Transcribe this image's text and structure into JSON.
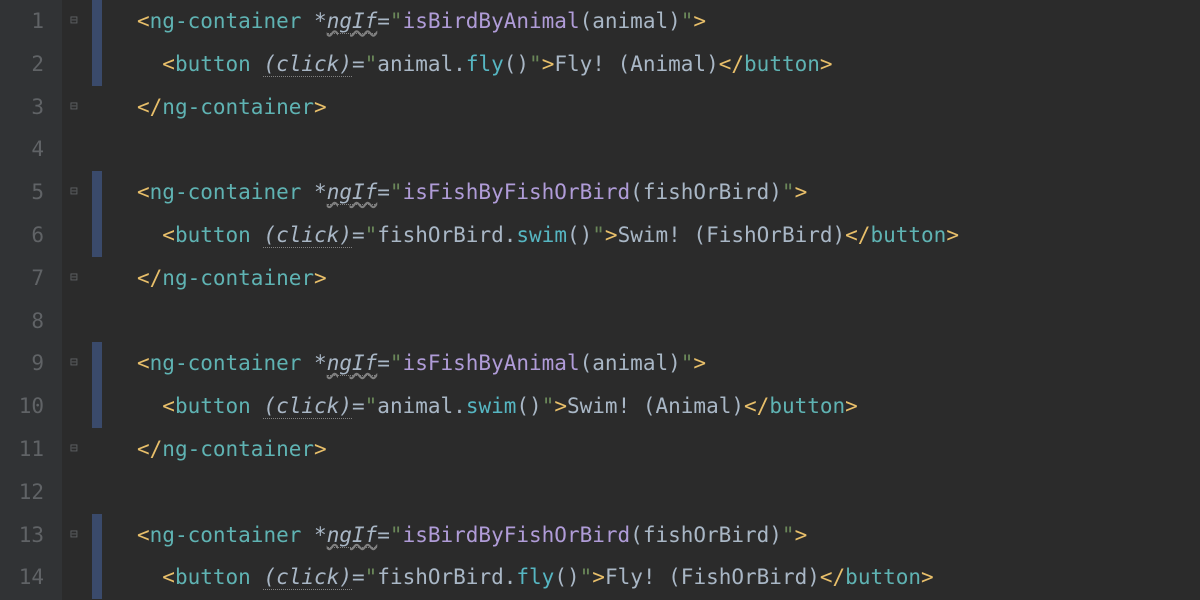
{
  "line_numbers": [
    "1",
    "2",
    "3",
    "4",
    "5",
    "6",
    "7",
    "8",
    "9",
    "10",
    "11",
    "12",
    "13",
    "14"
  ],
  "code_lines": [
    {
      "indent_bar": 1,
      "fold": "open",
      "tokens": [
        {
          "cls": "tag-punct",
          "t": "<"
        },
        {
          "cls": "tag-name",
          "t": "ng-container "
        },
        {
          "cls": "dir-star",
          "t": "*"
        },
        {
          "cls": "dir-name squiggle",
          "t": "ngIf"
        },
        {
          "cls": "attr-eq",
          "t": "="
        },
        {
          "cls": "str-q",
          "t": "\""
        },
        {
          "cls": "expr-fn",
          "t": "isBirdByAnimal"
        },
        {
          "cls": "expr-punct",
          "t": "("
        },
        {
          "cls": "expr-id",
          "t": "animal"
        },
        {
          "cls": "expr-punct",
          "t": ")"
        },
        {
          "cls": "str-q",
          "t": "\""
        },
        {
          "cls": "tag-punct",
          "t": ">"
        }
      ]
    },
    {
      "indent_bar": 1,
      "tokens": [
        {
          "cls": "plain-text",
          "t": "  "
        },
        {
          "cls": "tag-punct",
          "t": "<"
        },
        {
          "cls": "tag-name",
          "t": "button "
        },
        {
          "cls": "dir-name",
          "t": "(click)"
        },
        {
          "cls": "attr-eq",
          "t": "="
        },
        {
          "cls": "str-q",
          "t": "\""
        },
        {
          "cls": "expr-id",
          "t": "animal"
        },
        {
          "cls": "expr-punct",
          "t": "."
        },
        {
          "cls": "expr-method",
          "t": "fly"
        },
        {
          "cls": "expr-punct",
          "t": "()"
        },
        {
          "cls": "str-q",
          "t": "\""
        },
        {
          "cls": "tag-punct",
          "t": ">"
        },
        {
          "cls": "plain-text",
          "t": "Fly! (Animal)"
        },
        {
          "cls": "tag-punct",
          "t": "</"
        },
        {
          "cls": "tag-name",
          "t": "button"
        },
        {
          "cls": "tag-punct",
          "t": ">"
        }
      ]
    },
    {
      "fold": "close",
      "tokens": [
        {
          "cls": "tag-punct",
          "t": "</"
        },
        {
          "cls": "tag-name",
          "t": "ng-container"
        },
        {
          "cls": "tag-punct",
          "t": ">"
        }
      ]
    },
    {
      "tokens": []
    },
    {
      "indent_bar": 1,
      "fold": "open",
      "tokens": [
        {
          "cls": "tag-punct",
          "t": "<"
        },
        {
          "cls": "tag-name",
          "t": "ng-container "
        },
        {
          "cls": "dir-star",
          "t": "*"
        },
        {
          "cls": "dir-name squiggle",
          "t": "ngIf"
        },
        {
          "cls": "attr-eq",
          "t": "="
        },
        {
          "cls": "str-q",
          "t": "\""
        },
        {
          "cls": "expr-fn",
          "t": "isFishByFishOrBird"
        },
        {
          "cls": "expr-punct",
          "t": "("
        },
        {
          "cls": "expr-id",
          "t": "fishOrBird"
        },
        {
          "cls": "expr-punct",
          "t": ")"
        },
        {
          "cls": "str-q",
          "t": "\""
        },
        {
          "cls": "tag-punct",
          "t": ">"
        }
      ]
    },
    {
      "indent_bar": 1,
      "tokens": [
        {
          "cls": "plain-text",
          "t": "  "
        },
        {
          "cls": "tag-punct",
          "t": "<"
        },
        {
          "cls": "tag-name",
          "t": "button "
        },
        {
          "cls": "dir-name",
          "t": "(click)"
        },
        {
          "cls": "attr-eq",
          "t": "="
        },
        {
          "cls": "str-q",
          "t": "\""
        },
        {
          "cls": "expr-id",
          "t": "fishOrBird"
        },
        {
          "cls": "expr-punct",
          "t": "."
        },
        {
          "cls": "expr-method",
          "t": "swim"
        },
        {
          "cls": "expr-punct",
          "t": "()"
        },
        {
          "cls": "str-q",
          "t": "\""
        },
        {
          "cls": "tag-punct",
          "t": ">"
        },
        {
          "cls": "plain-text",
          "t": "Swim! (FishOrBird)"
        },
        {
          "cls": "tag-punct",
          "t": "</"
        },
        {
          "cls": "tag-name",
          "t": "button"
        },
        {
          "cls": "tag-punct",
          "t": ">"
        }
      ]
    },
    {
      "fold": "close",
      "tokens": [
        {
          "cls": "tag-punct",
          "t": "</"
        },
        {
          "cls": "tag-name",
          "t": "ng-container"
        },
        {
          "cls": "tag-punct",
          "t": ">"
        }
      ]
    },
    {
      "tokens": []
    },
    {
      "indent_bar": 1,
      "fold": "open",
      "tokens": [
        {
          "cls": "tag-punct",
          "t": "<"
        },
        {
          "cls": "tag-name",
          "t": "ng-container "
        },
        {
          "cls": "dir-star",
          "t": "*"
        },
        {
          "cls": "dir-name squiggle",
          "t": "ngIf"
        },
        {
          "cls": "attr-eq",
          "t": "="
        },
        {
          "cls": "str-q",
          "t": "\""
        },
        {
          "cls": "expr-fn",
          "t": "isFishByAnimal"
        },
        {
          "cls": "expr-punct",
          "t": "("
        },
        {
          "cls": "expr-id",
          "t": "animal"
        },
        {
          "cls": "expr-punct",
          "t": ")"
        },
        {
          "cls": "str-q",
          "t": "\""
        },
        {
          "cls": "tag-punct",
          "t": ">"
        }
      ]
    },
    {
      "indent_bar": 1,
      "tokens": [
        {
          "cls": "plain-text",
          "t": "  "
        },
        {
          "cls": "tag-punct",
          "t": "<"
        },
        {
          "cls": "tag-name",
          "t": "button "
        },
        {
          "cls": "dir-name",
          "t": "(click)"
        },
        {
          "cls": "attr-eq",
          "t": "="
        },
        {
          "cls": "str-q",
          "t": "\""
        },
        {
          "cls": "expr-id",
          "t": "animal"
        },
        {
          "cls": "expr-punct",
          "t": "."
        },
        {
          "cls": "expr-method",
          "t": "swim"
        },
        {
          "cls": "expr-punct",
          "t": "()"
        },
        {
          "cls": "str-q",
          "t": "\""
        },
        {
          "cls": "tag-punct",
          "t": ">"
        },
        {
          "cls": "plain-text",
          "t": "Swim! (Animal)"
        },
        {
          "cls": "tag-punct",
          "t": "</"
        },
        {
          "cls": "tag-name",
          "t": "button"
        },
        {
          "cls": "tag-punct",
          "t": ">"
        }
      ]
    },
    {
      "fold": "close",
      "tokens": [
        {
          "cls": "tag-punct",
          "t": "</"
        },
        {
          "cls": "tag-name",
          "t": "ng-container"
        },
        {
          "cls": "tag-punct",
          "t": ">"
        }
      ]
    },
    {
      "tokens": []
    },
    {
      "indent_bar": 1,
      "fold": "open",
      "tokens": [
        {
          "cls": "tag-punct",
          "t": "<"
        },
        {
          "cls": "tag-name",
          "t": "ng-container "
        },
        {
          "cls": "dir-star",
          "t": "*"
        },
        {
          "cls": "dir-name squiggle",
          "t": "ngIf"
        },
        {
          "cls": "attr-eq",
          "t": "="
        },
        {
          "cls": "str-q",
          "t": "\""
        },
        {
          "cls": "expr-fn",
          "t": "isBirdByFishOrBird"
        },
        {
          "cls": "expr-punct",
          "t": "("
        },
        {
          "cls": "expr-id",
          "t": "fishOrBird"
        },
        {
          "cls": "expr-punct",
          "t": ")"
        },
        {
          "cls": "str-q",
          "t": "\""
        },
        {
          "cls": "tag-punct",
          "t": ">"
        }
      ]
    },
    {
      "indent_bar": 1,
      "tokens": [
        {
          "cls": "plain-text",
          "t": "  "
        },
        {
          "cls": "tag-punct",
          "t": "<"
        },
        {
          "cls": "tag-name",
          "t": "button "
        },
        {
          "cls": "dir-name",
          "t": "(click)"
        },
        {
          "cls": "attr-eq",
          "t": "="
        },
        {
          "cls": "str-q",
          "t": "\""
        },
        {
          "cls": "expr-id",
          "t": "fishOrBird"
        },
        {
          "cls": "expr-punct",
          "t": "."
        },
        {
          "cls": "expr-method",
          "t": "fly"
        },
        {
          "cls": "expr-punct",
          "t": "()"
        },
        {
          "cls": "str-q",
          "t": "\""
        },
        {
          "cls": "tag-punct",
          "t": ">"
        },
        {
          "cls": "plain-text",
          "t": "Fly! (FishOrBird)"
        },
        {
          "cls": "tag-punct",
          "t": "</"
        },
        {
          "cls": "tag-name",
          "t": "button"
        },
        {
          "cls": "tag-punct",
          "t": ">"
        }
      ]
    }
  ]
}
